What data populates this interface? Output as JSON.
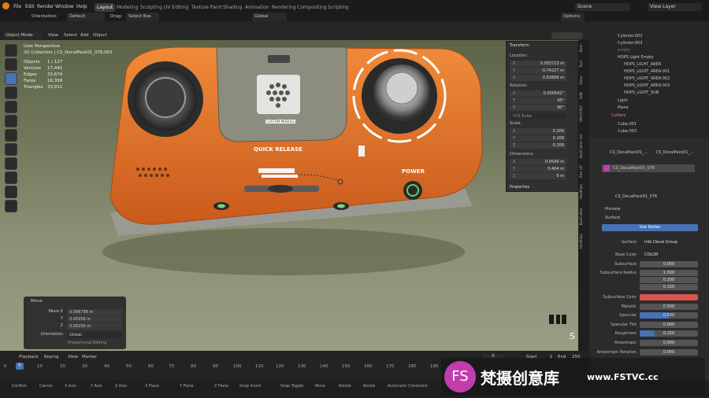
{
  "menus": [
    "File",
    "Edit",
    "Render",
    "Window",
    "Help"
  ],
  "workspaces": [
    "Layout",
    "Modeling",
    "Sculpting",
    "UV Editing",
    "Texture Paint",
    "Shading",
    "Animation",
    "Rendering",
    "Compositing",
    "Scripting"
  ],
  "scene": "Scene",
  "view_layer": "View Layer",
  "header2": {
    "orientation_label": "Orientation:",
    "orientation": "Default",
    "drag_label": "Drag:",
    "drag": "Select Box",
    "transform": "Global",
    "options": "Options"
  },
  "vp_header": {
    "mode": "Object Mode",
    "menus": [
      "View",
      "Select",
      "Add",
      "Object"
    ]
  },
  "overlay": {
    "perspective": "User Perspective",
    "collection": "(0) Collection | CS_DecalPack01_076.001",
    "stats": [
      [
        "Objects",
        "1 / 127"
      ],
      [
        "Vertices",
        "17,441"
      ],
      [
        "Edges",
        "33,674"
      ],
      [
        "Faces",
        "16,358"
      ],
      [
        "Triangles",
        "33,911"
      ]
    ]
  },
  "device": {
    "quick_release": "QUICK RELEASE",
    "power": "POWER",
    "custom_module": "CUSTOM MODULE"
  },
  "npanel": {
    "title": "Transform",
    "location": "Location:",
    "loc": [
      "0.003723 m",
      "-0.74227 m",
      "0.62666 m"
    ],
    "rotation": "Rotation:",
    "rot": [
      "0.000541°",
      "45°",
      "90°"
    ],
    "mode": "XYZ Euler",
    "scale": "Scale:",
    "scl": [
      "0.209",
      "0.209",
      "0.209"
    ],
    "dimensions": "Dimensions:",
    "dim": [
      "0.0549 m",
      "0.404 m",
      "0 m"
    ],
    "properties": "Properties"
  },
  "axes": [
    "X",
    "Y",
    "Z"
  ],
  "sidetabs": [
    "Item",
    "Tool",
    "View",
    "Edit",
    "MACHIN3",
    "BoxCutter Ver",
    "Zen UV",
    "HardOps",
    "BoxCutter",
    "HardOps"
  ],
  "outliner": [
    "Cylinder.002",
    "Cylinder.003",
    "empty",
    "HOPS Light Empty",
    "HOPS_LIGHT_AREA",
    "HOPS_LIGHT_AREA.001",
    "HOPS_LIGHT_AREA.002",
    "HOPS_LIGHT_AREA.003",
    "HOPS_LIGHT_SUN",
    "Light",
    "Plane",
    "Cutters",
    "Cube.001",
    "Cube.003"
  ],
  "props": {
    "object": "CS_DecalPack01_...",
    "mat_obj": "CS_DecalPack01_...",
    "material": "CS_DecalPack01_076",
    "material_slot": "CS_DecalPack01_076",
    "preview": "Preview",
    "surface": "Surface",
    "use_nodes": "Use Nodes",
    "rows": [
      [
        "Surface",
        "Info Decal Group"
      ],
      [
        "Base Color",
        "COLOR"
      ],
      [
        "Subsurface",
        "0.000"
      ],
      [
        "Subsurface Radius",
        "1.000"
      ],
      [
        "",
        "0.200"
      ],
      [
        "",
        "0.100"
      ],
      [
        "Subsurface Color",
        ""
      ],
      [
        "Metallic",
        "0.000"
      ],
      [
        "Specular",
        "0.500"
      ],
      [
        "Specular Tint",
        "0.000"
      ],
      [
        "Roughness",
        "0.250"
      ],
      [
        "Anisotropic",
        "0.000"
      ],
      [
        "Anisotropic Rotation",
        "0.000"
      ]
    ]
  },
  "move": {
    "title": "Move",
    "rows": [
      [
        "Move X",
        "0.006798 m"
      ],
      [
        "Y",
        "0.00256 m"
      ],
      [
        "Z",
        "0.00256 m"
      ]
    ],
    "orientation_label": "Orientation",
    "orientation": "Global",
    "proportional": "Proportional Editing"
  },
  "timeline": {
    "menus": [
      "Playback",
      "Keying",
      "View",
      "Marker"
    ],
    "frame": "0",
    "start_label": "Start",
    "start": "1",
    "end_label": "End",
    "end": "250",
    "ticks": [
      "0",
      "10",
      "20",
      "30",
      "40",
      "50",
      "60",
      "70",
      "80",
      "90",
      "100",
      "110",
      "120",
      "130",
      "140",
      "150",
      "160",
      "170",
      "180",
      "190"
    ],
    "current": "5"
  },
  "status": [
    "Confirm",
    "Cancel",
    "X Axis",
    "Y Axis",
    "Z Axis",
    "X Plane",
    "Y Plane",
    "Z Plane",
    "Snap Invert",
    "Snap Toggle",
    "Move",
    "Rotate",
    "Resize",
    "Automatic Constraint"
  ],
  "watermark": {
    "cn": "梵摄创意库",
    "url": "www.FSTVC.cc",
    "logo": "FS"
  },
  "colors": {
    "accent": "#4772b3",
    "orange": "#e0702a",
    "subsurface_color": "#d9534f",
    "material": "#c13dae"
  }
}
